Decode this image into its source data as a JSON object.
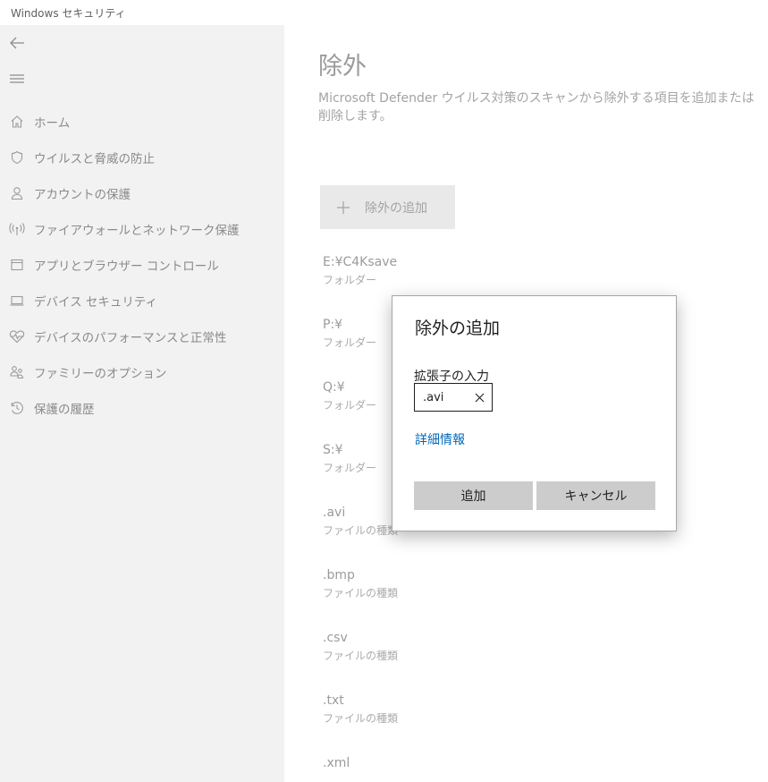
{
  "window": {
    "title": "Windows セキュリティ"
  },
  "sidebar": {
    "items": [
      {
        "label": "ホーム",
        "icon": "home-icon"
      },
      {
        "label": "ウイルスと脅威の防止",
        "icon": "shield-icon"
      },
      {
        "label": "アカウントの保護",
        "icon": "person-icon"
      },
      {
        "label": "ファイアウォールとネットワーク保護",
        "icon": "antenna-icon"
      },
      {
        "label": "アプリとブラウザー コントロール",
        "icon": "app-window-icon"
      },
      {
        "label": "デバイス セキュリティ",
        "icon": "laptop-icon"
      },
      {
        "label": "デバイスのパフォーマンスと正常性",
        "icon": "heartbeat-icon"
      },
      {
        "label": "ファミリーのオプション",
        "icon": "family-icon"
      },
      {
        "label": "保護の履歴",
        "icon": "history-icon"
      }
    ]
  },
  "main": {
    "title": "除外",
    "description": "Microsoft Defender ウイルス対策のスキャンから除外する項目を追加または削除します。",
    "add_button_label": "除外の追加",
    "exclusions": [
      {
        "name": "E:¥C4Ksave",
        "type": "フォルダー"
      },
      {
        "name": "P:¥",
        "type": "フォルダー"
      },
      {
        "name": "Q:¥",
        "type": "フォルダー"
      },
      {
        "name": "S:¥",
        "type": "フォルダー"
      },
      {
        "name": ".avi",
        "type": "ファイルの種類"
      },
      {
        "name": ".bmp",
        "type": "ファイルの種類"
      },
      {
        "name": ".csv",
        "type": "ファイルの種類"
      },
      {
        "name": ".txt",
        "type": "ファイルの種類"
      },
      {
        "name": ".xml",
        "type": ""
      }
    ]
  },
  "dialog": {
    "title": "除外の追加",
    "field_label": "拡張子の入力",
    "field_value": ".avi",
    "learn_more": "詳細情報",
    "add_button": "追加",
    "cancel_button": "キャンセル"
  },
  "colors": {
    "sidebar_bg": "#f2f2f2",
    "link": "#0067b8",
    "dialog_button": "#cccccc"
  }
}
